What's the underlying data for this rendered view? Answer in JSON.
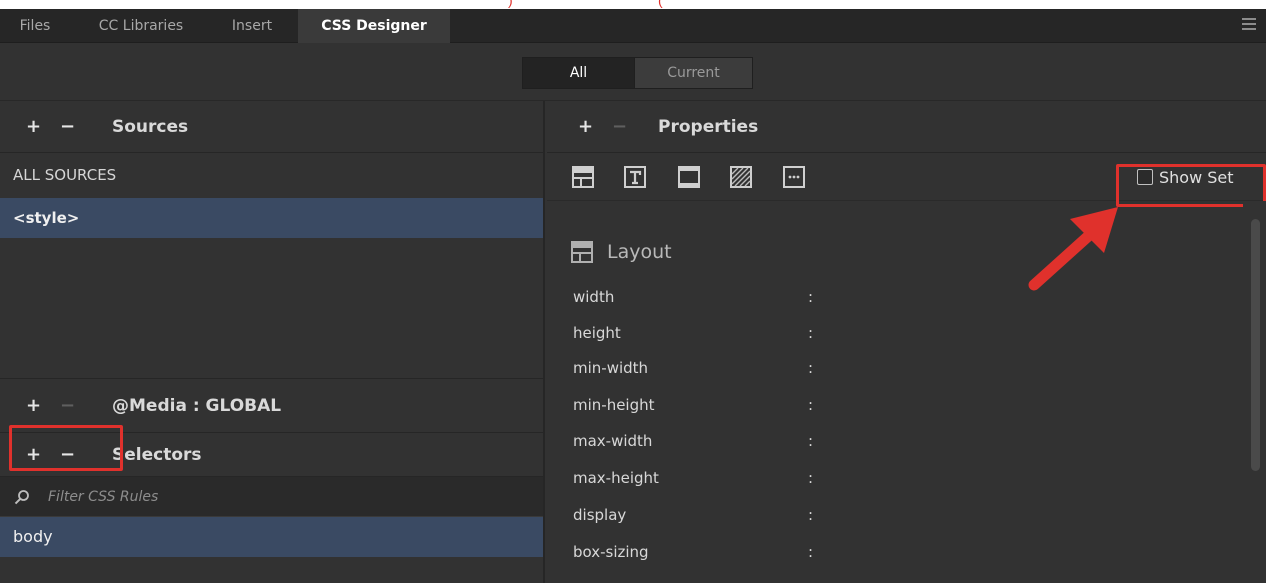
{
  "colors": {
    "panel_bg": "#323232",
    "tabbar_bg": "#262626",
    "selection": "#3a4a63",
    "annotation_red": "#e0312c"
  },
  "tabs": [
    {
      "label": "Files",
      "active": false
    },
    {
      "label": "CC Libraries",
      "active": false
    },
    {
      "label": "Insert",
      "active": false
    },
    {
      "label": "CSS Designer",
      "active": true
    }
  ],
  "mode_toggle": {
    "all": "All",
    "current": "Current",
    "selected": "All"
  },
  "sources": {
    "plus": "+",
    "minus": "−",
    "title": "Sources",
    "items": [
      {
        "label": "ALL SOURCES",
        "selected": false
      },
      {
        "label": "<style>",
        "selected": true
      }
    ]
  },
  "media": {
    "plus": "+",
    "minus": "−",
    "title": "@Media :  GLOBAL"
  },
  "selectors": {
    "plus": "+",
    "minus": "−",
    "title": "Selectors",
    "filter_placeholder": "Filter CSS Rules",
    "items": [
      {
        "label": "body",
        "selected": true
      }
    ]
  },
  "properties": {
    "plus": "+",
    "minus": "−",
    "title": "Properties",
    "category_icons": [
      "layout-icon",
      "text-icon",
      "border-icon",
      "background-icon",
      "more-icon"
    ],
    "show_set_label": "Show Set",
    "show_set_checked": false,
    "section_title": "Layout",
    "rows": [
      {
        "name": "width",
        "colon": ":"
      },
      {
        "name": "height",
        "colon": ":"
      },
      {
        "name": "min-width",
        "colon": ":"
      },
      {
        "name": "min-height",
        "colon": ":"
      },
      {
        "name": "max-width",
        "colon": ":"
      },
      {
        "name": "max-height",
        "colon": ":"
      },
      {
        "name": "display",
        "colon": ":"
      },
      {
        "name": "box-sizing",
        "colon": ":"
      }
    ]
  }
}
